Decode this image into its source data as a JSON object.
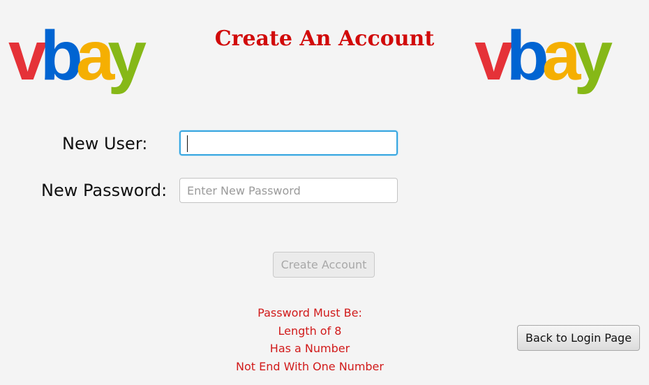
{
  "logo": {
    "letters": [
      "v",
      "b",
      "a",
      "y"
    ],
    "colors": {
      "v": "#e53238",
      "b": "#0064d2",
      "a": "#f5af02",
      "y": "#86b817"
    }
  },
  "title": "Create An Account",
  "form": {
    "user_label": "New User:",
    "user_value": "",
    "password_label": "New Password:",
    "password_placeholder": "Enter New Password",
    "password_value": "",
    "create_button": "Create Account"
  },
  "rules": [
    "Password Must Be:",
    "Length of 8",
    "Has a Number",
    "Not End With One Number"
  ],
  "back_button": "Back to Login Page",
  "colors": {
    "title": "#d10a0a",
    "rules": "#d11a1a",
    "focus_border": "#3aa7e0",
    "background": "#f4f4f4"
  }
}
